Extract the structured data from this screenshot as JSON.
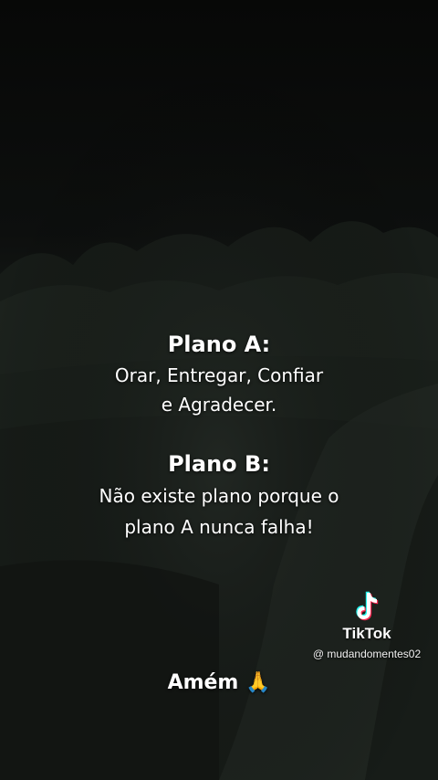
{
  "colors": {
    "background": "#0a0b0a",
    "text": "#ffffff"
  },
  "caption": {
    "plan_a_title": "Plano A:",
    "plan_a_lines": [
      "Orar, Entregar, Confiar",
      "e Agradecer."
    ],
    "plan_b_title": "Plano B:",
    "plan_b_lines": [
      "Não existe plano porque o",
      "plano A nunca falha!"
    ]
  },
  "watermark": {
    "brand": "TikTok",
    "handle": "@ mudandomentes02",
    "icon": "tiktok-logo-icon"
  },
  "footer": {
    "text": "Amém",
    "emoji": "🙏"
  }
}
